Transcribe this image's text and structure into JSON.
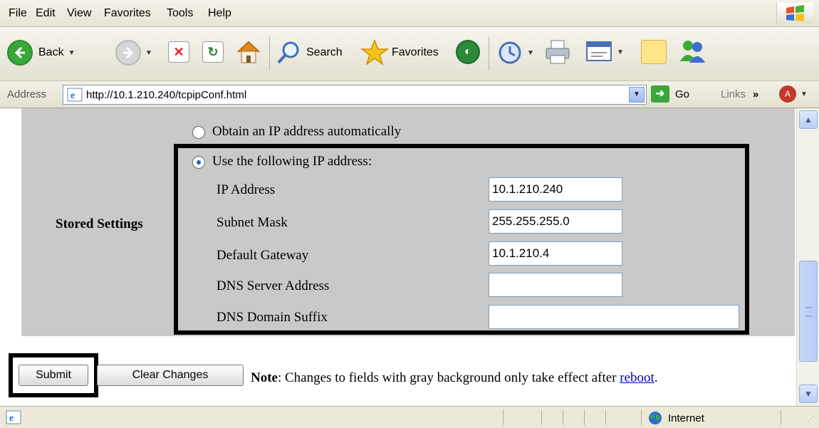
{
  "menu": [
    "File",
    "Edit",
    "View",
    "Favorites",
    "Tools",
    "Help"
  ],
  "toolbar": {
    "back_label": "Back",
    "search_label": "Search",
    "favorites_label": "Favorites"
  },
  "address": {
    "label": "Address",
    "url": "http://10.1.210.240/tcpipConf.html",
    "go_label": "Go",
    "links_label": "Links"
  },
  "form": {
    "section_label": "Stored Settings",
    "radio_auto": "Obtain an IP address automatically",
    "radio_manual": "Use the following IP address:",
    "selected": "manual",
    "fields": [
      {
        "label": "IP Address",
        "value": "10.1.210.240"
      },
      {
        "label": "Subnet Mask",
        "value": "255.255.255.0"
      },
      {
        "label": "Default Gateway",
        "value": "10.1.210.4"
      },
      {
        "label": "DNS Server Address",
        "value": ""
      },
      {
        "label": "DNS Domain Suffix",
        "value": ""
      }
    ]
  },
  "actions": {
    "submit_label": "Submit",
    "clear_label": "Clear Changes",
    "note_bold": "Note",
    "note_text": ": Changes to fields with gray background only take effect after ",
    "note_link": "reboot",
    "note_end": "."
  },
  "status": {
    "zone": "Internet"
  }
}
